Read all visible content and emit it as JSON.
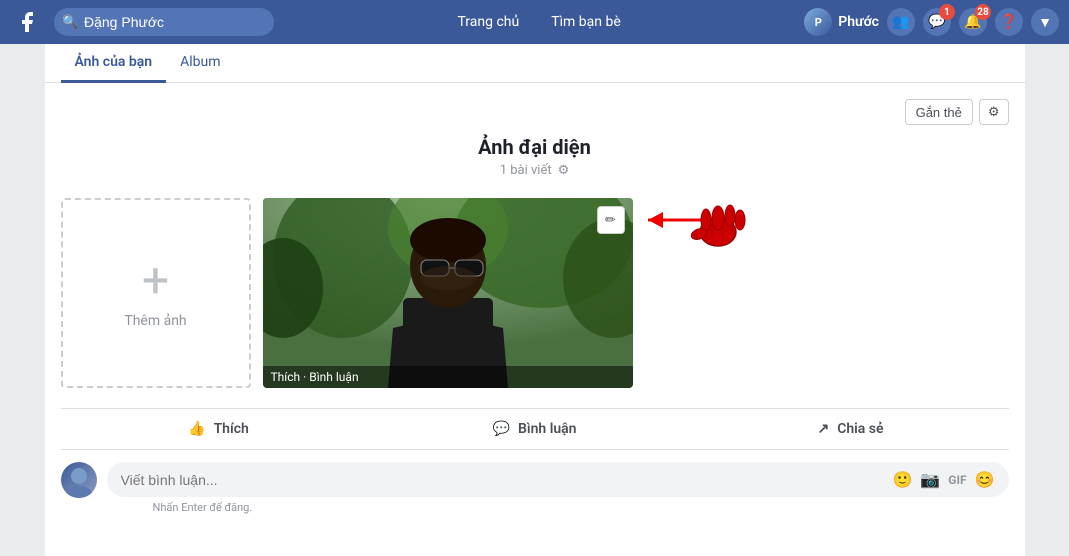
{
  "topnav": {
    "search_placeholder": "Đặng Phước",
    "profile_name": "Phước",
    "nav_items": [
      "Trang chủ",
      "Tìm bạn bè"
    ],
    "notification_count_1": "1",
    "notification_count_2": "28"
  },
  "subnav": {
    "items": [
      {
        "label": "Ảnh của bạn",
        "active": true
      },
      {
        "label": "Album",
        "active": false
      }
    ]
  },
  "photo_section": {
    "title": "Ảnh đại diện",
    "subtitle": "1 bài viết",
    "tag_button": "Gắn thẻ",
    "add_photo_label": "Thêm ảnh",
    "overlay_text": "Thích · Bình luận"
  },
  "actions": {
    "like": "Thích",
    "comment": "Bình luận",
    "share": "Chia sẻ"
  },
  "comment_box": {
    "placeholder": "Viết bình luận...",
    "hint": "Nhấn Enter để đăng."
  }
}
